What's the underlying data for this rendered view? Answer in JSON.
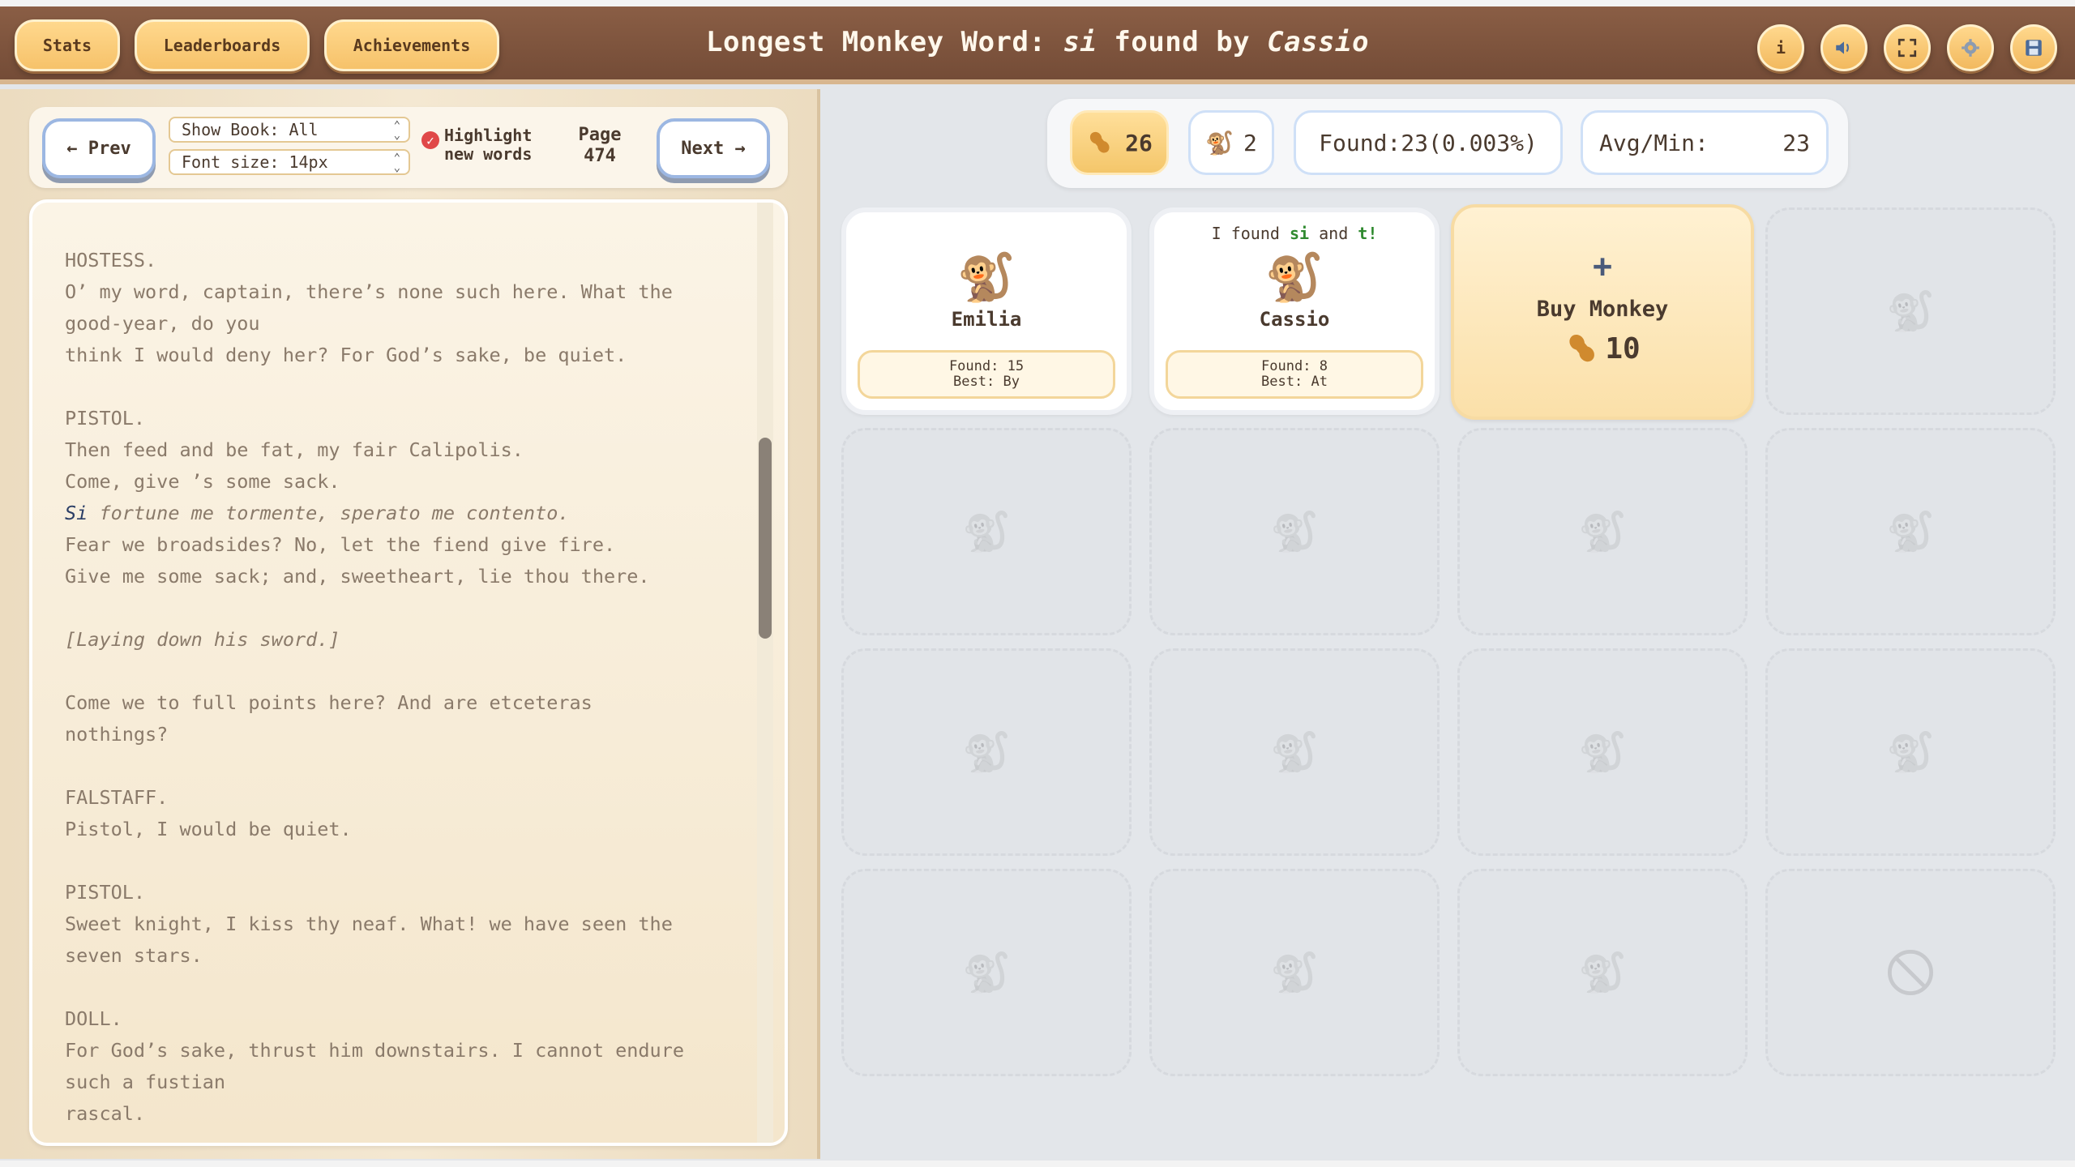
{
  "header": {
    "buttons": {
      "stats": "Stats",
      "leaderboards": "Leaderboards",
      "achievements": "Achievements"
    },
    "title_prefix": "Longest Monkey Word:",
    "title_word": "si",
    "title_mid": "found by",
    "title_author": "Cassio",
    "icons": [
      "info-icon",
      "sound-icon",
      "fullscreen-icon",
      "settings-icon",
      "save-icon"
    ],
    "info_label": "i"
  },
  "reader": {
    "prev_label": "← Prev",
    "next_label": "Next →",
    "show_book_value": "Show Book: All",
    "font_size_value": "Font size: 14px",
    "highlight_checked": true,
    "highlight_label_1": "Highlight",
    "highlight_label_2": "new words",
    "page_label": "Page",
    "page_number": "474",
    "lines": [
      "HOSTESS.",
      "O’ my word, captain, there’s none such here. What the",
      "good-year, do you",
      "think I would deny her? For God’s sake, be quiet.",
      "",
      "PISTOL.",
      "Then feed and be fat, my fair Calipolis.",
      "Come, give ’s some sack.",
      "Si| fortune me tormente, sperato me contento.",
      "Fear we broadsides? No, let the fiend give fire.",
      "Give me some sack; and, sweetheart, lie thou there.",
      "",
      " [Laying down his sword.]",
      "",
      "Come we to full points here? And are etceteras",
      "nothings?",
      "",
      "FALSTAFF.",
      "Pistol, I would be quiet.",
      "",
      "PISTOL.",
      "Sweet knight, I kiss thy neaf. What! we have seen the",
      "seven stars.",
      "",
      "DOLL.",
      "For God’s sake, thrust him downstairs. I cannot endure",
      "such a fustian",
      "rascal."
    ]
  },
  "stats": {
    "peanuts": "26",
    "monkeys": "2",
    "found": "Found:23(0.003%)",
    "avg_label": "Avg/Min:",
    "avg_value": "23"
  },
  "monkeys": [
    {
      "name": "Emilia",
      "found": "Found: 15",
      "best": "Best: By",
      "speech": ""
    },
    {
      "name": "Cassio",
      "found": "Found: 8",
      "best": "Best: At",
      "speech_prefix": "I found",
      "speech_word1": "si",
      "speech_and": "and",
      "speech_word2": "t!"
    }
  ],
  "buy": {
    "plus": "+",
    "label": "Buy Monkey",
    "price": "10"
  },
  "colors": {
    "header": "#7d5540",
    "accent": "#f6c26a",
    "highlight_word": "#2b3e66"
  }
}
